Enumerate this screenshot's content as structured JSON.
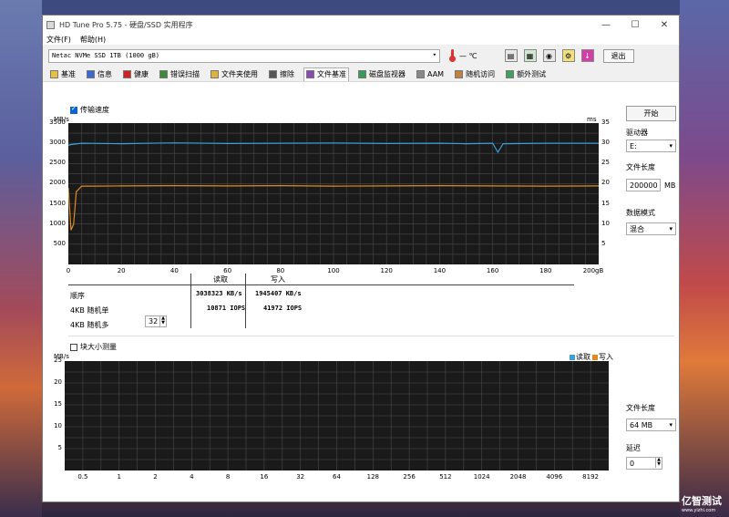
{
  "window": {
    "title": "HD Tune Pro 5.75 - 硬盘/SSD 实用程序",
    "controls": {
      "minimize": "—",
      "maximize": "☐",
      "close": "✕"
    }
  },
  "menu": [
    "文件(F)",
    "帮助(H)"
  ],
  "toolbar": {
    "drive": "Netac NVMe SSD 1TB (1000 gB)",
    "temperature": "— ℃",
    "exit_label": "退出"
  },
  "tabs": [
    {
      "label": "基准",
      "icon": "benchmark-icon",
      "color": "#e8c040"
    },
    {
      "label": "信息",
      "icon": "info-icon",
      "color": "#3a6cd0"
    },
    {
      "label": "健康",
      "icon": "health-icon",
      "color": "#d02020"
    },
    {
      "label": "错误扫描",
      "icon": "error-scan-icon",
      "color": "#3a8a3a"
    },
    {
      "label": "文件夹使用",
      "icon": "folder-icon",
      "color": "#e0b040"
    },
    {
      "label": "擦除",
      "icon": "erase-icon",
      "color": "#555555"
    },
    {
      "label": "文件基准",
      "icon": "file-benchmark-icon",
      "color": "#8a4ab0"
    },
    {
      "label": "磁盘监视器",
      "icon": "disk-monitor-icon",
      "color": "#3a9a5a"
    },
    {
      "label": "AAM",
      "icon": "aam-icon",
      "color": "#888888"
    },
    {
      "label": "随机访问",
      "icon": "random-access-icon",
      "color": "#c08040"
    },
    {
      "label": "额外测试",
      "icon": "extra-tests-icon",
      "color": "#40a060"
    }
  ],
  "active_tab": "文件基准",
  "transfer_checkbox": "传输速度",
  "block_checkbox": "块大小测量",
  "results": {
    "col_read": "读取",
    "col_write": "写入",
    "rows": [
      {
        "label": "顺序",
        "read": "3038323 KB/s",
        "write": "1945407 KB/s"
      },
      {
        "label": "4KB 随机单",
        "read": "10871 IOPS",
        "write": "41972 IOPS"
      },
      {
        "label": "4KB 随机多",
        "read": "",
        "write": ""
      }
    ],
    "queue_depth": "32"
  },
  "side_panel": {
    "start_label": "开始",
    "drive_label": "驱动器",
    "drive_value": "E:",
    "file_length_label": "文件长度",
    "file_length_value": "200000",
    "file_length_unit": "MB",
    "data_mode_label": "数据模式",
    "data_mode_value": "混合",
    "file_length2_label": "文件长度",
    "file_length2_value": "64 MB",
    "delay_label": "延迟",
    "delay_value": "0"
  },
  "watermark": {
    "text": "亿智测试",
    "sub": "www.yizhi.com"
  },
  "chart_data": [
    {
      "type": "line",
      "ylabel": "MB/s",
      "y2label": "ms",
      "xunit": "gB",
      "x_ticks": [
        0,
        20,
        40,
        60,
        80,
        100,
        120,
        140,
        160,
        180,
        200
      ],
      "x_tick_labels": [
        "0",
        "20",
        "40",
        "60",
        "80",
        "100",
        "120",
        "140",
        "160",
        "180",
        "200gB"
      ],
      "y_ticks": [
        500,
        1000,
        1500,
        2000,
        2500,
        3000,
        3500
      ],
      "y_tick_labels": [
        "500",
        "1000",
        "1500",
        "2000",
        "2500",
        "3000",
        "3500"
      ],
      "y2_ticks": [
        5,
        10,
        15,
        20,
        25,
        30,
        35
      ],
      "y2_tick_labels": [
        "5",
        "10",
        "15",
        "20",
        "25",
        "30",
        "35"
      ],
      "xlim": [
        0,
        200
      ],
      "ylim": [
        0,
        3500
      ],
      "series": [
        {
          "name": "读取",
          "color": "#3aa0d8",
          "x": [
            0,
            1,
            5,
            20,
            40,
            60,
            80,
            100,
            120,
            140,
            150,
            160,
            162,
            164,
            180,
            200
          ],
          "values": [
            2950,
            2970,
            3000,
            2990,
            3010,
            2995,
            3000,
            3005,
            2995,
            3000,
            2990,
            3000,
            2780,
            2990,
            3000,
            3000
          ]
        },
        {
          "name": "写入",
          "color": "#e08a20",
          "x": [
            0,
            1,
            2,
            3,
            5,
            10,
            20,
            40,
            60,
            80,
            100,
            120,
            140,
            160,
            180,
            200
          ],
          "values": [
            1900,
            850,
            1000,
            1800,
            1940,
            1940,
            1945,
            1950,
            1945,
            1950,
            1940,
            1945,
            1950,
            1945,
            1940,
            1945
          ]
        }
      ]
    },
    {
      "type": "line",
      "ylabel": "MB/s",
      "x_tick_labels": [
        "0.5",
        "1",
        "2",
        "4",
        "8",
        "16",
        "32",
        "64",
        "128",
        "256",
        "512",
        "1024",
        "2048",
        "4096",
        "8192"
      ],
      "y_ticks": [
        5,
        10,
        15,
        20,
        25
      ],
      "y_tick_labels": [
        "5",
        "10",
        "15",
        "20",
        "25"
      ],
      "ylim": [
        0,
        25
      ],
      "legend": [
        "读取",
        "写入"
      ],
      "legend_colors": [
        "#3aa0d8",
        "#e08a20"
      ],
      "legend_position": "top-right",
      "series": []
    }
  ]
}
